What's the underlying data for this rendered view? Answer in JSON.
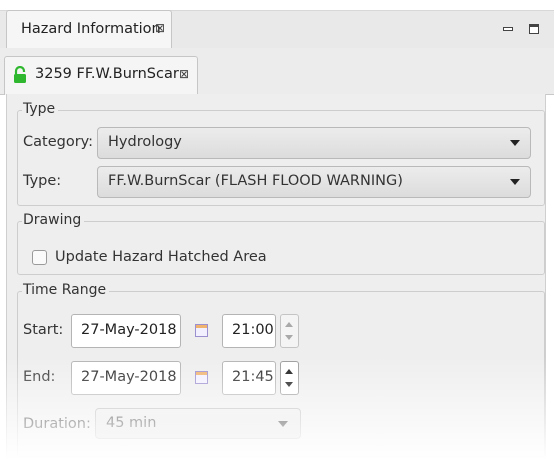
{
  "view": {
    "title": "Hazard Information",
    "close_glyph": "⊠",
    "icons": [
      "minimize-icon",
      "maximize-icon"
    ]
  },
  "editor_tab": {
    "title": "3259 FF.W.BurnScar",
    "close_glyph": "⊠",
    "icon": "unlocked-padlock-icon",
    "icon_color": "#2fb82f"
  },
  "type_group": {
    "legend": "Type",
    "category_label": "Category:",
    "category_value": "Hydrology",
    "type_label": "Type:",
    "type_value": "FF.W.BurnScar (FLASH FLOOD WARNING)"
  },
  "drawing_group": {
    "legend": "Drawing",
    "checkbox_label": "Update Hazard Hatched Area",
    "checked": false
  },
  "time_group": {
    "legend": "Time Range",
    "start_label": "Start:",
    "start_date": "27-May-2018",
    "start_time": "21:00",
    "end_label": "End:",
    "end_date": "27-May-2018",
    "end_time": "21:45",
    "duration_label": "Duration:",
    "duration_value": "45 min"
  },
  "colors": {
    "panel_bg": "#eeeeee",
    "lock_green": "#2fb82f"
  }
}
